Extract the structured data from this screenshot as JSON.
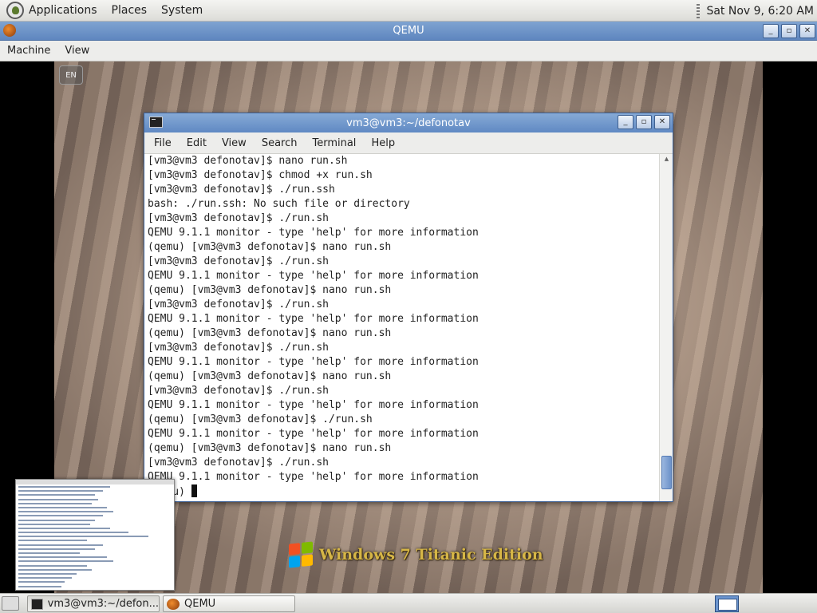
{
  "top_panel": {
    "menus": [
      "Applications",
      "Places",
      "System"
    ],
    "clock": "Sat Nov 9, 6:20 AM"
  },
  "qemu": {
    "title": "QEMU",
    "menu": [
      "Machine",
      "View"
    ]
  },
  "guest": {
    "lang": "EN",
    "logo_text": "Windows 7 Titanic Edition"
  },
  "terminal": {
    "title": "vm3@vm3:~/defonotav",
    "menu": [
      "File",
      "Edit",
      "View",
      "Search",
      "Terminal",
      "Help"
    ],
    "lines": [
      "[vm3@vm3 defonotav]$ nano run.sh",
      "[vm3@vm3 defonotav]$ chmod +x run.sh",
      "[vm3@vm3 defonotav]$ ./run.ssh",
      "bash: ./run.ssh: No such file or directory",
      "[vm3@vm3 defonotav]$ ./run.sh",
      "QEMU 9.1.1 monitor - type 'help' for more information",
      "(qemu) [vm3@vm3 defonotav]$ nano run.sh",
      "[vm3@vm3 defonotav]$ ./run.sh",
      "QEMU 9.1.1 monitor - type 'help' for more information",
      "(qemu) [vm3@vm3 defonotav]$ nano run.sh",
      "[vm3@vm3 defonotav]$ ./run.sh",
      "QEMU 9.1.1 monitor - type 'help' for more information",
      "(qemu) [vm3@vm3 defonotav]$ nano run.sh",
      "[vm3@vm3 defonotav]$ ./run.sh",
      "QEMU 9.1.1 monitor - type 'help' for more information",
      "(qemu) [vm3@vm3 defonotav]$ nano run.sh",
      "[vm3@vm3 defonotav]$ ./run.sh",
      "QEMU 9.1.1 monitor - type 'help' for more information",
      "(qemu) [vm3@vm3 defonotav]$ ./run.sh",
      "QEMU 9.1.1 monitor - type 'help' for more information",
      "(qemu) [vm3@vm3 defonotav]$ nano run.sh",
      "[vm3@vm3 defonotav]$ ./run.sh",
      "QEMU 9.1.1 monitor - type 'help' for more information"
    ],
    "prompt": "(qemu) "
  },
  "taskbar": {
    "tasks": [
      "vm3@vm3:~/defon...",
      "QEMU"
    ]
  },
  "colors": {
    "titlebar": "#6089c3",
    "panel": "#e6e6e2"
  }
}
